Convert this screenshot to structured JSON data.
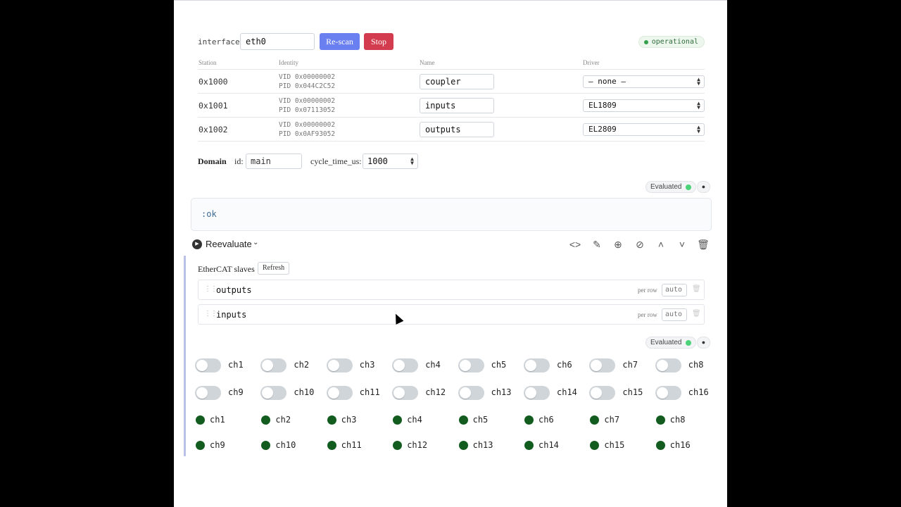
{
  "iface": {
    "label": "interface",
    "value": "eth0",
    "rescan_label": "Re-scan",
    "stop_label": "Stop",
    "status": "operational",
    "status_color": "#35a04b"
  },
  "table": {
    "headers": [
      "Station",
      "Identity",
      "Name",
      "Driver"
    ],
    "rows": [
      {
        "station": "0x1000",
        "vid": "VID 0x00000002",
        "pid": "PID 0x044C2C52",
        "name": "coupler",
        "driver": "— none —"
      },
      {
        "station": "0x1001",
        "vid": "VID 0x00000002",
        "pid": "PID 0x07113052",
        "name": "inputs",
        "driver": "EL1809"
      },
      {
        "station": "0x1002",
        "vid": "VID 0x00000002",
        "pid": "PID 0x0AF93052",
        "name": "outputs",
        "driver": "EL2809"
      }
    ]
  },
  "domain": {
    "title": "Domain",
    "id_label": "id:",
    "id_value": "main",
    "cycle_label": "cycle_time_us:",
    "cycle_value": "1000"
  },
  "eval": {
    "label": "Evaluated",
    "dot_color": "#4cd37a"
  },
  "output": {
    "text": ":ok"
  },
  "toolbar": {
    "reevaluate_label": "Reevaluate",
    "icons": [
      "code-icon",
      "pencil-icon",
      "zoom-icon",
      "link-icon",
      "arrow-up-icon",
      "arrow-down-icon",
      "trash-icon"
    ]
  },
  "slaves_widget": {
    "title": "EtherCAT slaves",
    "refresh_label": "Refresh",
    "per_row_label": "per row",
    "per_row_value": "auto",
    "items": [
      "outputs",
      "inputs"
    ]
  },
  "switches": {
    "row1": [
      "ch1",
      "ch2",
      "ch3",
      "ch4",
      "ch5",
      "ch6",
      "ch7",
      "ch8"
    ],
    "row2": [
      "ch9",
      "ch10",
      "ch11",
      "ch12",
      "ch13",
      "ch14",
      "ch15",
      "ch16"
    ]
  },
  "leds": {
    "color": "#135c1f",
    "row1": [
      "ch1",
      "ch2",
      "ch3",
      "ch4",
      "ch5",
      "ch6",
      "ch7",
      "ch8"
    ],
    "row2": [
      "ch9",
      "ch10",
      "ch11",
      "ch12",
      "ch13",
      "ch14",
      "ch15",
      "ch16"
    ]
  }
}
